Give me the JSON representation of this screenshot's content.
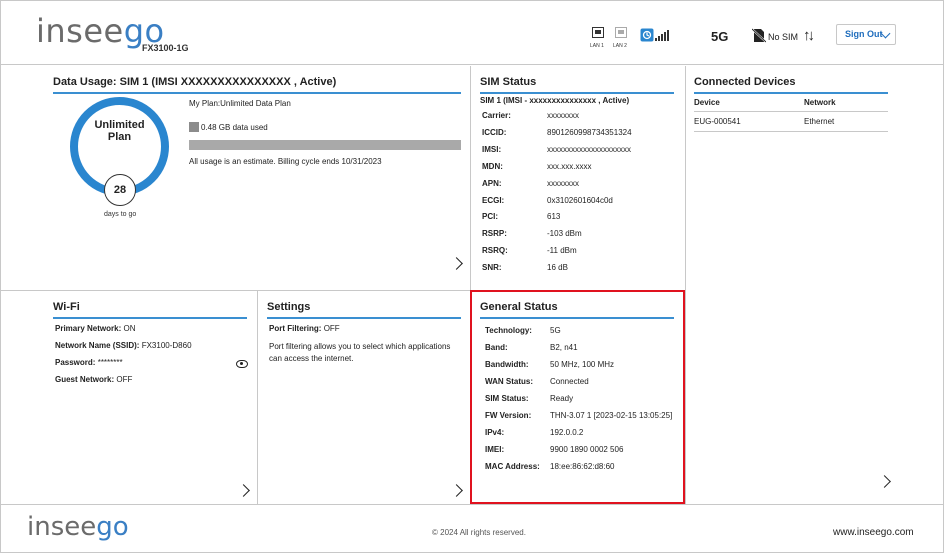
{
  "header": {
    "logo_left": "insee",
    "logo_right": "go",
    "model": "FX3100-1G",
    "lan1": "LAN 1",
    "lan2": "LAN 2",
    "network_type": "5G",
    "sim_status": "No SIM",
    "sign_out": "Sign Out"
  },
  "data_usage": {
    "title": "Data Usage:  SIM 1 (IMSI    XXXXXXXXXXXXXXX , Active)",
    "plan_line1": "Unlimited",
    "plan_line2": "Plan",
    "days": "28",
    "days_label": "days to go",
    "my_plan": "My Plan:Unlimited Data Plan",
    "used": "0.48 GB data used",
    "note": "All usage is an estimate. Billing cycle ends 10/31/2023"
  },
  "sim_status": {
    "title": "SIM Status",
    "subtitle": "SIM 1 (IMSI -    xxxxxxxxxxxxxxx , Active)",
    "rows": [
      {
        "label": "Carrier:",
        "value": "xxxxxxxx"
      },
      {
        "label": "ICCID:",
        "value": "8901260998734351324"
      },
      {
        "label": "IMSI:",
        "value": "xxxxxxxxxxxxxxxxxxxxx"
      },
      {
        "label": "MDN:",
        "value": "xxx.xxx.xxxx"
      },
      {
        "label": "APN:",
        "value": "xxxxxxxx"
      },
      {
        "label": "ECGI:",
        "value": "0x3102601604c0d"
      },
      {
        "label": "PCI:",
        "value": "613"
      },
      {
        "label": "RSRP:",
        "value": "-103 dBm"
      },
      {
        "label": "RSRQ:",
        "value": "-11 dBm"
      },
      {
        "label": "SNR:",
        "value": "16 dB"
      }
    ]
  },
  "connected_devices": {
    "title": "Connected Devices",
    "col_device": "Device",
    "col_network": "Network",
    "rows": [
      {
        "device": "EUG-000541",
        "network": "Ethernet"
      }
    ]
  },
  "wifi": {
    "title": "Wi-Fi",
    "rows": [
      {
        "label": "Primary Network:",
        "value": "ON"
      },
      {
        "label": "Network Name (SSID):",
        "value": "FX3100-D860"
      },
      {
        "label": "Password:",
        "value": "********"
      },
      {
        "label": "Guest Network:",
        "value": "OFF"
      }
    ]
  },
  "settings": {
    "title": "Settings",
    "port_label": "Port Filtering:",
    "port_value": "OFF",
    "desc_line1": "Port filtering allows you to select which applications",
    "desc_line2": "can access the internet."
  },
  "general_status": {
    "title": "General Status",
    "rows": [
      {
        "label": "Technology:",
        "value": "5G"
      },
      {
        "label": "Band:",
        "value": "B2, n41"
      },
      {
        "label": "Bandwidth:",
        "value": "50 MHz, 100 MHz"
      },
      {
        "label": "WAN Status:",
        "value": "Connected"
      },
      {
        "label": "SIM Status:",
        "value": "Ready"
      },
      {
        "label": "FW Version:",
        "value": "THN-3.07 1 [2023-02-15 13:05:25]"
      },
      {
        "label": "IPv4:",
        "value": "192.0.0.2"
      },
      {
        "label": "IMEI:",
        "value": "9900 1890 0002 506"
      },
      {
        "label": "MAC Address:",
        "value": "18:ee:86:62:d8:60"
      }
    ]
  },
  "footer": {
    "logo_left": "insee",
    "logo_right": "go",
    "copyright": "© 2024 All rights reserved.",
    "website": "www.inseego.com"
  },
  "colors": {
    "accent": "#2a86cf",
    "highlight": "#e0121f",
    "link": "#1f6dbd"
  }
}
